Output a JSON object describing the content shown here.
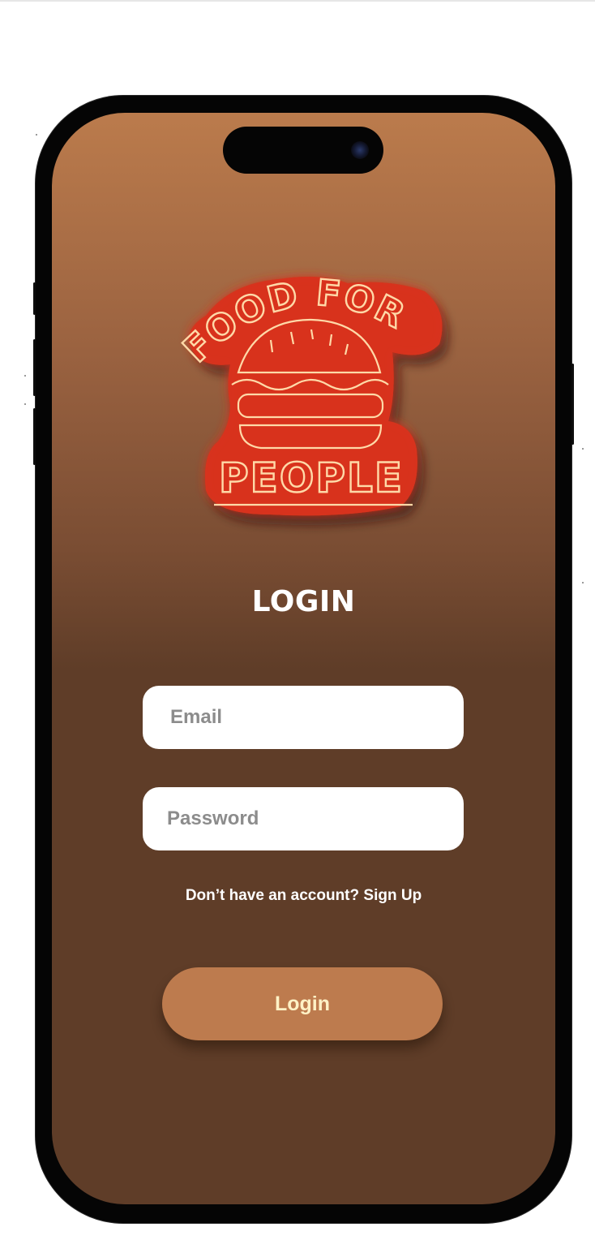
{
  "app": {
    "logo_text_top": "FOOD FOR",
    "logo_text_bottom": "PEOPLE"
  },
  "login": {
    "title": "LOGIN",
    "email_placeholder": "Email",
    "email_value": "",
    "password_placeholder": "Password",
    "password_value": "",
    "signup_prompt": "Don’t have an account?",
    "signup_link": "Sign Up",
    "button_label": "Login"
  },
  "colors": {
    "gradient_top": "#bb7b4c",
    "gradient_bottom": "#5f3d28",
    "button": "#bd7b4e",
    "button_text": "#fff2c6",
    "neon_red": "#d8321c",
    "field_bg": "#ffffff"
  },
  "icons": [
    "burger-neon-icon",
    "camera-icon"
  ]
}
